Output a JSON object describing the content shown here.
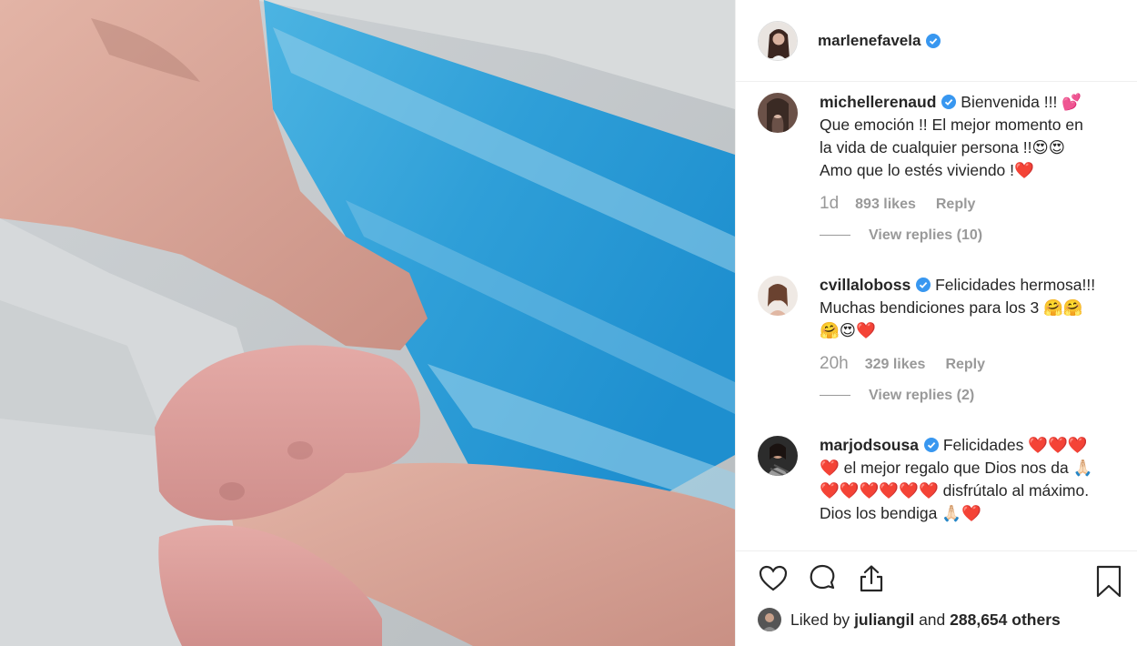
{
  "post": {
    "author": "marlenefavela",
    "photo_description": ""
  },
  "comments": [
    {
      "user": "michellerenaud",
      "text": "Bienvenida !!! 💕 Que emoción !! El mejor momento en la vida de cualquier persona !!😍😍 Amo que lo estés viviendo !❤️",
      "time": "1d",
      "likes": "893 likes",
      "reply": "Reply",
      "view_replies": "View replies (10)"
    },
    {
      "user": "cvillaloboss",
      "text": "Felicidades hermosa!!! Muchas bendiciones para los 3 🤗🤗🤗😍❤️",
      "time": "20h",
      "likes": "329 likes",
      "reply": "Reply",
      "view_replies": "View replies (2)"
    },
    {
      "user": "marjodsousa",
      "text": "Felicidades ❤️❤️❤️❤️ el mejor regalo que Dios nos da 🙏🏻❤️❤️❤️❤️❤️❤️ disfrútalo al máximo. Dios los bendiga 🙏🏻❤️"
    }
  ],
  "liked_by": {
    "prefix": "Liked by",
    "user": "juliangil",
    "conjunction": "and",
    "others": "288,654 others"
  },
  "icons": [
    "heart-icon",
    "comment-icon",
    "share-icon",
    "bookmark-icon",
    "verified-badge-icon"
  ],
  "colors": {
    "verified": "#3897f0",
    "muted_text": "#999999",
    "primary_text": "#262626",
    "blanket_blue": "#3aa8dc"
  }
}
